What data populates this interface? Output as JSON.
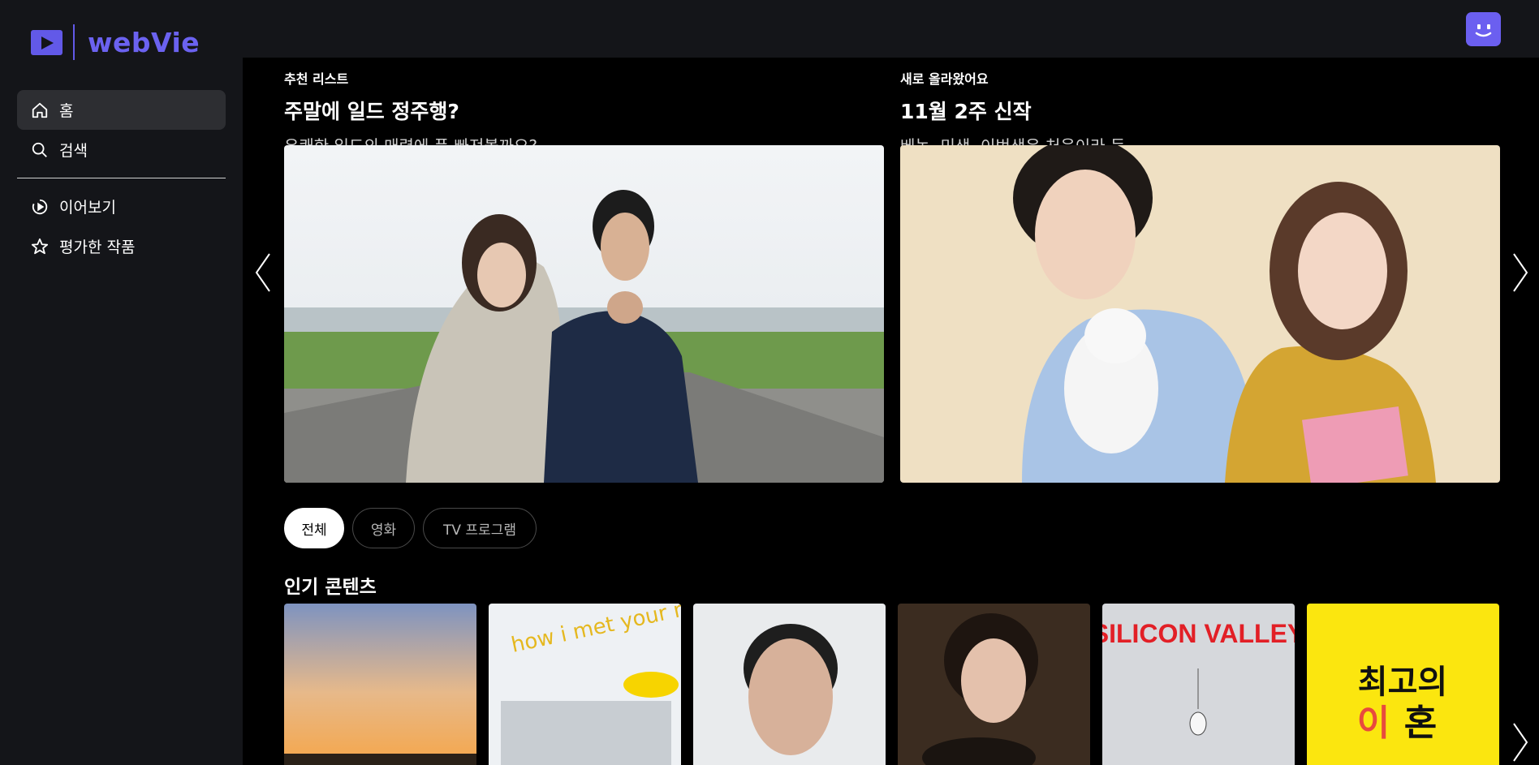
{
  "brand": {
    "name": "webVie",
    "color": "#6259e8"
  },
  "sidebar": {
    "items": [
      {
        "label": "홈",
        "icon": "home-icon",
        "active": true
      },
      {
        "label": "검색",
        "icon": "search-icon"
      },
      {
        "label": "이어보기",
        "icon": "continue-watching-icon"
      },
      {
        "label": "평가한 작품",
        "icon": "star-icon"
      }
    ]
  },
  "header": {
    "avatar_icon": "smiley-avatar-icon"
  },
  "banners": [
    {
      "eyebrow": "추천 리스트",
      "title": "주말에 일드 정주행?",
      "subtitle": "유쾌한 일드의 매력에 푹 빠져볼까요?"
    },
    {
      "eyebrow": "새로 올라왔어요",
      "title": "11월 2주 신작",
      "subtitle": "베놈, 미생, 이번생은 처음이라 등"
    }
  ],
  "filters": [
    {
      "label": "전체",
      "active": true
    },
    {
      "label": "영화"
    },
    {
      "label": "TV 프로그램"
    }
  ],
  "popular": {
    "title": "인기 콘텐츠",
    "posters": [
      {
        "text": ""
      },
      {
        "text": "how i met your mother"
      },
      {
        "text": ""
      },
      {
        "text": ""
      },
      {
        "text": "SILICON VALLEY"
      },
      {
        "text_line1": "최고의",
        "text_line2_a": "이",
        "text_line2_b": "혼"
      }
    ]
  }
}
